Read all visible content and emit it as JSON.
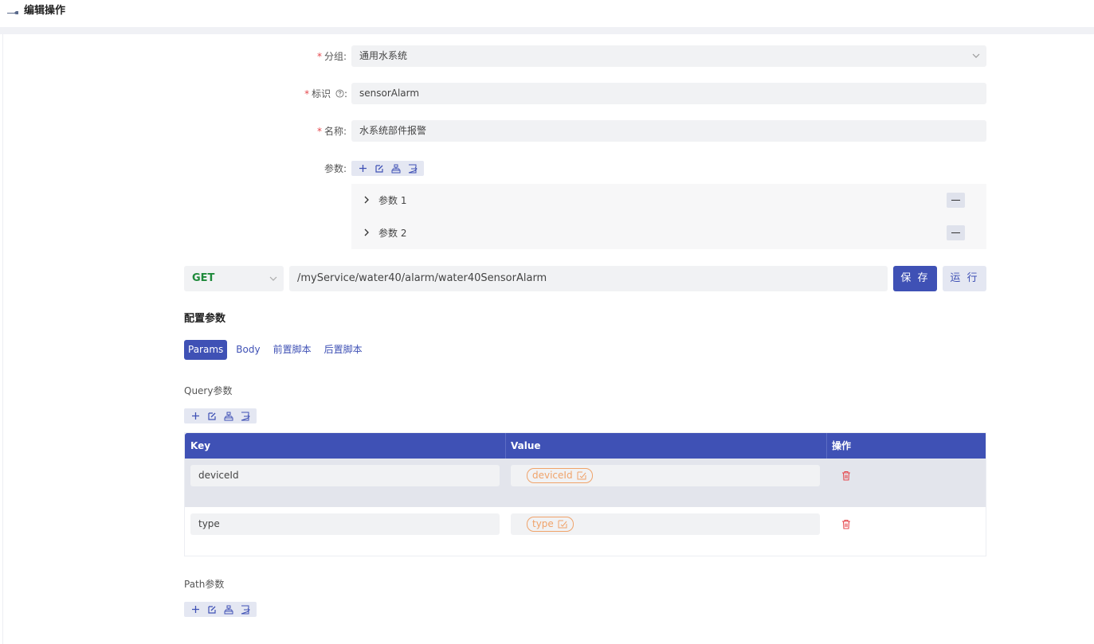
{
  "header": {
    "title": "编辑操作"
  },
  "form": {
    "group_label": "分组:",
    "group_value": "通用水系统",
    "id_label": "标识",
    "id_colon": ":",
    "id_value": "sensorAlarm",
    "name_label": "名称:",
    "name_value": "水系统部件报警",
    "params_label": "参数:"
  },
  "params": [
    {
      "label": "参数 1"
    },
    {
      "label": "参数 2"
    }
  ],
  "request": {
    "method": "GET",
    "url": "/myService/water40/alarm/water40SensorAlarm",
    "save_label": "保 存",
    "run_label": "运 行"
  },
  "config": {
    "title": "配置参数",
    "tabs": [
      {
        "label": "Params",
        "active": true
      },
      {
        "label": "Body",
        "active": false
      },
      {
        "label": "前置脚本",
        "active": false
      },
      {
        "label": "后置脚本",
        "active": false
      }
    ],
    "query_label": "Query参数",
    "path_label": "Path参数"
  },
  "table": {
    "columns": [
      "Key",
      "Value",
      "操作"
    ],
    "rows": [
      {
        "key": "deviceId",
        "value": "deviceId"
      },
      {
        "key": "type",
        "value": "type"
      }
    ]
  },
  "icons": {
    "title": "wrench-icon",
    "toolset": [
      "plus-icon",
      "edit-icon",
      "structure-icon",
      "export-icon"
    ],
    "row_delete": "trash-icon"
  },
  "colors": {
    "primary": "#3f51b5",
    "method_get": "#1f8a3b",
    "required": "#e5484d",
    "tag": "#f0a36a",
    "delete": "#e5484d"
  }
}
